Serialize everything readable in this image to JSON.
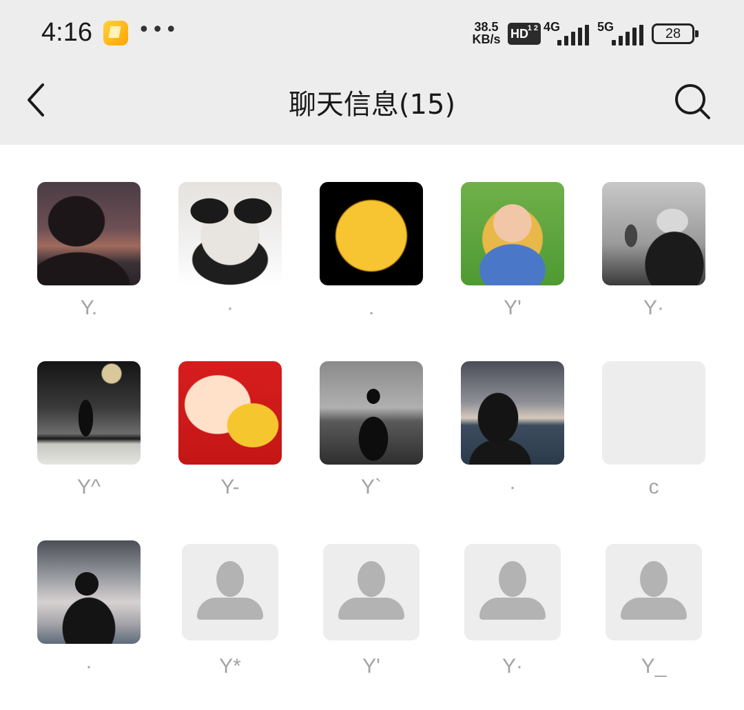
{
  "status_bar": {
    "time": "4:16",
    "more_icon": "ellipsis-icon",
    "notification_icon": "notes-app-icon",
    "speed_value": "38.5",
    "speed_unit": "KB/s",
    "hd_label": "HD",
    "hd_sub": "1 2",
    "network_1": "4G",
    "network_2": "5G",
    "battery": "28"
  },
  "nav": {
    "back_icon": "chevron-left-icon",
    "title": "聊天信息(15)",
    "search_icon": "search-icon"
  },
  "members": [
    {
      "name": "Y.",
      "avatar": "photo"
    },
    {
      "name": "·",
      "avatar": "photo"
    },
    {
      "name": ".",
      "avatar": "photo"
    },
    {
      "name": "Y'",
      "avatar": "photo"
    },
    {
      "name": "Y·",
      "avatar": "photo"
    },
    {
      "name": "Y^",
      "avatar": "photo"
    },
    {
      "name": "Y-",
      "avatar": "photo"
    },
    {
      "name": "Y`",
      "avatar": "photo"
    },
    {
      "name": "·",
      "avatar": "photo"
    },
    {
      "name": "c",
      "avatar": "blank"
    },
    {
      "name": "·",
      "avatar": "photo"
    },
    {
      "name": "Y*",
      "avatar": "default-person-icon"
    },
    {
      "name": "Y'",
      "avatar": "default-person-icon"
    },
    {
      "name": "Y·",
      "avatar": "default-person-icon"
    },
    {
      "name": "Y_",
      "avatar": "default-person-icon"
    }
  ],
  "colors": {
    "header_bg": "#ededed",
    "name_text": "#a3a3a3",
    "placeholder_bg": "#ededed",
    "placeholder_figure": "#b3b3b3"
  }
}
